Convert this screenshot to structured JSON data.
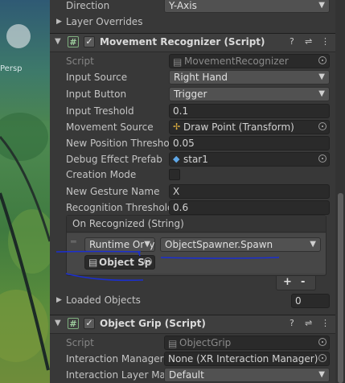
{
  "scene": {
    "label": "Persp"
  },
  "top": {
    "direction": {
      "label": "Direction",
      "value": "Y-Axis"
    },
    "layer_overrides": {
      "label": "Layer Overrides"
    }
  },
  "movement_recognizer": {
    "title": "Movement Recognizer (Script)",
    "fields": {
      "script": {
        "label": "Script",
        "value": "MovementRecognizer"
      },
      "input_source": {
        "label": "Input Source",
        "value": "Right Hand"
      },
      "input_button": {
        "label": "Input Button",
        "value": "Trigger"
      },
      "input_threshold": {
        "label": "Input Treshold",
        "value": "0.1"
      },
      "movement_source": {
        "label": "Movement Source",
        "value": "Draw Point (Transform)"
      },
      "new_position_threshold": {
        "label": "New Position Threshold",
        "value": "0.05"
      },
      "debug_effect_prefab": {
        "label": "Debug Effect Prefab",
        "value": "star1"
      },
      "creation_mode": {
        "label": "Creation Mode"
      },
      "new_gesture_name": {
        "label": "New Gesture Name",
        "value": "X"
      },
      "recognition_threshold": {
        "label": "Recognition Threshold",
        "value": "0.6"
      }
    },
    "on_recognized": {
      "title": "On Recognized (String)",
      "runtime": "Runtime Only",
      "function": "ObjectSpawner.Spawn",
      "object": "Object Sp",
      "add": "+",
      "remove": "-"
    },
    "loaded_objects": {
      "label": "Loaded Objects",
      "value": "0"
    }
  },
  "object_grip": {
    "title": "Object Grip (Script)",
    "fields": {
      "script": {
        "label": "Script",
        "value": "ObjectGrip"
      },
      "interaction_manager": {
        "label": "Interaction Manager",
        "value": "None (XR Interaction Manager)"
      },
      "interaction_layer_mask": {
        "label": "Interaction Layer Mask",
        "value": "Default"
      }
    }
  },
  "colors": {
    "annotation": "#1b2fd0",
    "inspector_bg": "#383838"
  }
}
